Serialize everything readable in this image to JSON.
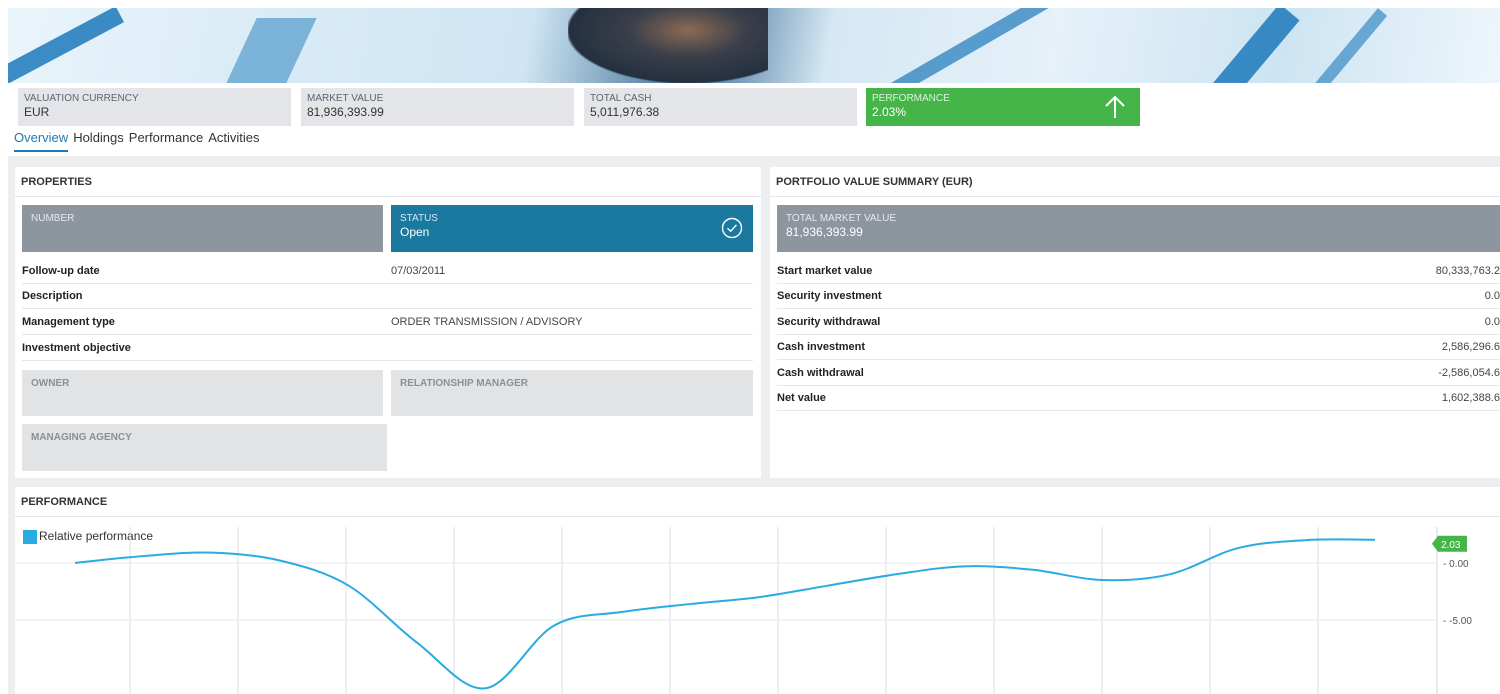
{
  "kpis": {
    "valuation_currency": {
      "label": "VALUATION CURRENCY",
      "value": "EUR"
    },
    "market_value": {
      "label": "MARKET VALUE",
      "value": "81,936,393.99"
    },
    "total_cash": {
      "label": "TOTAL CASH",
      "value": "5,011,976.38"
    },
    "performance": {
      "label": "PERFORMANCE",
      "value": "2.03%",
      "icon": "arrow-up-icon",
      "color": "#45b549"
    }
  },
  "tabs": [
    "Overview",
    "Holdings",
    "Performance",
    "Activities"
  ],
  "properties": {
    "title": "PROPERTIES",
    "number_label": "NUMBER",
    "status_label": "STATUS",
    "status_value": "Open",
    "status_color": "#1b789f",
    "rows": [
      {
        "label": "Follow-up date",
        "value": "07/03/2011"
      },
      {
        "label": "Description",
        "value": ""
      },
      {
        "label": "Management type",
        "value": "ORDER TRANSMISSION / ADVISORY"
      },
      {
        "label": "Investment objective",
        "value": ""
      }
    ],
    "owner_label": "OWNER",
    "relationship_manager_label": "RELATIONSHIP MANAGER",
    "managing_agency_label": "MANAGING AGENCY"
  },
  "summary": {
    "title": "PORTFOLIO VALUE SUMMARY (EUR)",
    "total_label": "TOTAL MARKET VALUE",
    "total_value": "81,936,393.99",
    "rows": [
      {
        "label": "Start market value",
        "value": "80,333,763.2"
      },
      {
        "label": "Security investment",
        "value": "0.0"
      },
      {
        "label": "Security withdrawal",
        "value": "0.0"
      },
      {
        "label": "Cash investment",
        "value": "2,586,296.6"
      },
      {
        "label": "Cash withdrawal",
        "value": "-2,586,054.6"
      },
      {
        "label": "Net value",
        "value": "1,602,388.6"
      }
    ]
  },
  "performance": {
    "title": "PERFORMANCE",
    "legend": "Relative performance",
    "series_color": "#29abe2",
    "last_value_badge": "2.03",
    "badge_color": "#45b549"
  },
  "chart_data": {
    "type": "line",
    "series": [
      {
        "name": "Relative performance",
        "values": [
          0.0,
          0.6,
          0.9,
          0.2,
          -2.0,
          -7.0,
          -11.0,
          -5.5,
          -4.3,
          -3.6,
          -3.0,
          -2.0,
          -1.0,
          -0.3,
          -0.6,
          -1.5,
          -1.0,
          1.3,
          2.0,
          2.03
        ]
      }
    ],
    "y_ticks": [
      "0.00",
      "-5.00"
    ],
    "ylim": [
      -11.5,
      3.5
    ],
    "grid": true
  }
}
